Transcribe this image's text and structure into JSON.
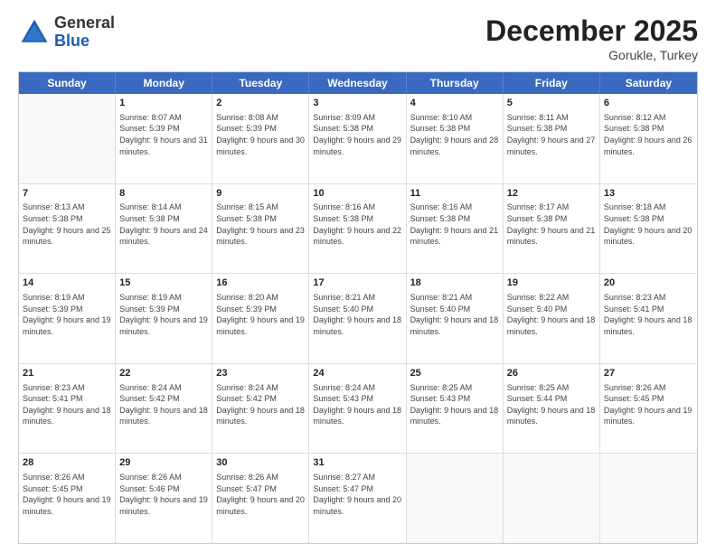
{
  "header": {
    "logo": {
      "line1": "General",
      "line2": "Blue"
    },
    "title": "December 2025",
    "location": "Gorukle, Turkey"
  },
  "weekdays": [
    "Sunday",
    "Monday",
    "Tuesday",
    "Wednesday",
    "Thursday",
    "Friday",
    "Saturday"
  ],
  "weeks": [
    [
      {
        "day": "",
        "sunrise": "",
        "sunset": "",
        "daylight": ""
      },
      {
        "day": "1",
        "sunrise": "Sunrise: 8:07 AM",
        "sunset": "Sunset: 5:39 PM",
        "daylight": "Daylight: 9 hours and 31 minutes."
      },
      {
        "day": "2",
        "sunrise": "Sunrise: 8:08 AM",
        "sunset": "Sunset: 5:39 PM",
        "daylight": "Daylight: 9 hours and 30 minutes."
      },
      {
        "day": "3",
        "sunrise": "Sunrise: 8:09 AM",
        "sunset": "Sunset: 5:38 PM",
        "daylight": "Daylight: 9 hours and 29 minutes."
      },
      {
        "day": "4",
        "sunrise": "Sunrise: 8:10 AM",
        "sunset": "Sunset: 5:38 PM",
        "daylight": "Daylight: 9 hours and 28 minutes."
      },
      {
        "day": "5",
        "sunrise": "Sunrise: 8:11 AM",
        "sunset": "Sunset: 5:38 PM",
        "daylight": "Daylight: 9 hours and 27 minutes."
      },
      {
        "day": "6",
        "sunrise": "Sunrise: 8:12 AM",
        "sunset": "Sunset: 5:38 PM",
        "daylight": "Daylight: 9 hours and 26 minutes."
      }
    ],
    [
      {
        "day": "7",
        "sunrise": "Sunrise: 8:13 AM",
        "sunset": "Sunset: 5:38 PM",
        "daylight": "Daylight: 9 hours and 25 minutes."
      },
      {
        "day": "8",
        "sunrise": "Sunrise: 8:14 AM",
        "sunset": "Sunset: 5:38 PM",
        "daylight": "Daylight: 9 hours and 24 minutes."
      },
      {
        "day": "9",
        "sunrise": "Sunrise: 8:15 AM",
        "sunset": "Sunset: 5:38 PM",
        "daylight": "Daylight: 9 hours and 23 minutes."
      },
      {
        "day": "10",
        "sunrise": "Sunrise: 8:16 AM",
        "sunset": "Sunset: 5:38 PM",
        "daylight": "Daylight: 9 hours and 22 minutes."
      },
      {
        "day": "11",
        "sunrise": "Sunrise: 8:16 AM",
        "sunset": "Sunset: 5:38 PM",
        "daylight": "Daylight: 9 hours and 21 minutes."
      },
      {
        "day": "12",
        "sunrise": "Sunrise: 8:17 AM",
        "sunset": "Sunset: 5:38 PM",
        "daylight": "Daylight: 9 hours and 21 minutes."
      },
      {
        "day": "13",
        "sunrise": "Sunrise: 8:18 AM",
        "sunset": "Sunset: 5:38 PM",
        "daylight": "Daylight: 9 hours and 20 minutes."
      }
    ],
    [
      {
        "day": "14",
        "sunrise": "Sunrise: 8:19 AM",
        "sunset": "Sunset: 5:39 PM",
        "daylight": "Daylight: 9 hours and 19 minutes."
      },
      {
        "day": "15",
        "sunrise": "Sunrise: 8:19 AM",
        "sunset": "Sunset: 5:39 PM",
        "daylight": "Daylight: 9 hours and 19 minutes."
      },
      {
        "day": "16",
        "sunrise": "Sunrise: 8:20 AM",
        "sunset": "Sunset: 5:39 PM",
        "daylight": "Daylight: 9 hours and 19 minutes."
      },
      {
        "day": "17",
        "sunrise": "Sunrise: 8:21 AM",
        "sunset": "Sunset: 5:40 PM",
        "daylight": "Daylight: 9 hours and 18 minutes."
      },
      {
        "day": "18",
        "sunrise": "Sunrise: 8:21 AM",
        "sunset": "Sunset: 5:40 PM",
        "daylight": "Daylight: 9 hours and 18 minutes."
      },
      {
        "day": "19",
        "sunrise": "Sunrise: 8:22 AM",
        "sunset": "Sunset: 5:40 PM",
        "daylight": "Daylight: 9 hours and 18 minutes."
      },
      {
        "day": "20",
        "sunrise": "Sunrise: 8:23 AM",
        "sunset": "Sunset: 5:41 PM",
        "daylight": "Daylight: 9 hours and 18 minutes."
      }
    ],
    [
      {
        "day": "21",
        "sunrise": "Sunrise: 8:23 AM",
        "sunset": "Sunset: 5:41 PM",
        "daylight": "Daylight: 9 hours and 18 minutes."
      },
      {
        "day": "22",
        "sunrise": "Sunrise: 8:24 AM",
        "sunset": "Sunset: 5:42 PM",
        "daylight": "Daylight: 9 hours and 18 minutes."
      },
      {
        "day": "23",
        "sunrise": "Sunrise: 8:24 AM",
        "sunset": "Sunset: 5:42 PM",
        "daylight": "Daylight: 9 hours and 18 minutes."
      },
      {
        "day": "24",
        "sunrise": "Sunrise: 8:24 AM",
        "sunset": "Sunset: 5:43 PM",
        "daylight": "Daylight: 9 hours and 18 minutes."
      },
      {
        "day": "25",
        "sunrise": "Sunrise: 8:25 AM",
        "sunset": "Sunset: 5:43 PM",
        "daylight": "Daylight: 9 hours and 18 minutes."
      },
      {
        "day": "26",
        "sunrise": "Sunrise: 8:25 AM",
        "sunset": "Sunset: 5:44 PM",
        "daylight": "Daylight: 9 hours and 18 minutes."
      },
      {
        "day": "27",
        "sunrise": "Sunrise: 8:26 AM",
        "sunset": "Sunset: 5:45 PM",
        "daylight": "Daylight: 9 hours and 19 minutes."
      }
    ],
    [
      {
        "day": "28",
        "sunrise": "Sunrise: 8:26 AM",
        "sunset": "Sunset: 5:45 PM",
        "daylight": "Daylight: 9 hours and 19 minutes."
      },
      {
        "day": "29",
        "sunrise": "Sunrise: 8:26 AM",
        "sunset": "Sunset: 5:46 PM",
        "daylight": "Daylight: 9 hours and 19 minutes."
      },
      {
        "day": "30",
        "sunrise": "Sunrise: 8:26 AM",
        "sunset": "Sunset: 5:47 PM",
        "daylight": "Daylight: 9 hours and 20 minutes."
      },
      {
        "day": "31",
        "sunrise": "Sunrise: 8:27 AM",
        "sunset": "Sunset: 5:47 PM",
        "daylight": "Daylight: 9 hours and 20 minutes."
      },
      {
        "day": "",
        "sunrise": "",
        "sunset": "",
        "daylight": ""
      },
      {
        "day": "",
        "sunrise": "",
        "sunset": "",
        "daylight": ""
      },
      {
        "day": "",
        "sunrise": "",
        "sunset": "",
        "daylight": ""
      }
    ]
  ]
}
